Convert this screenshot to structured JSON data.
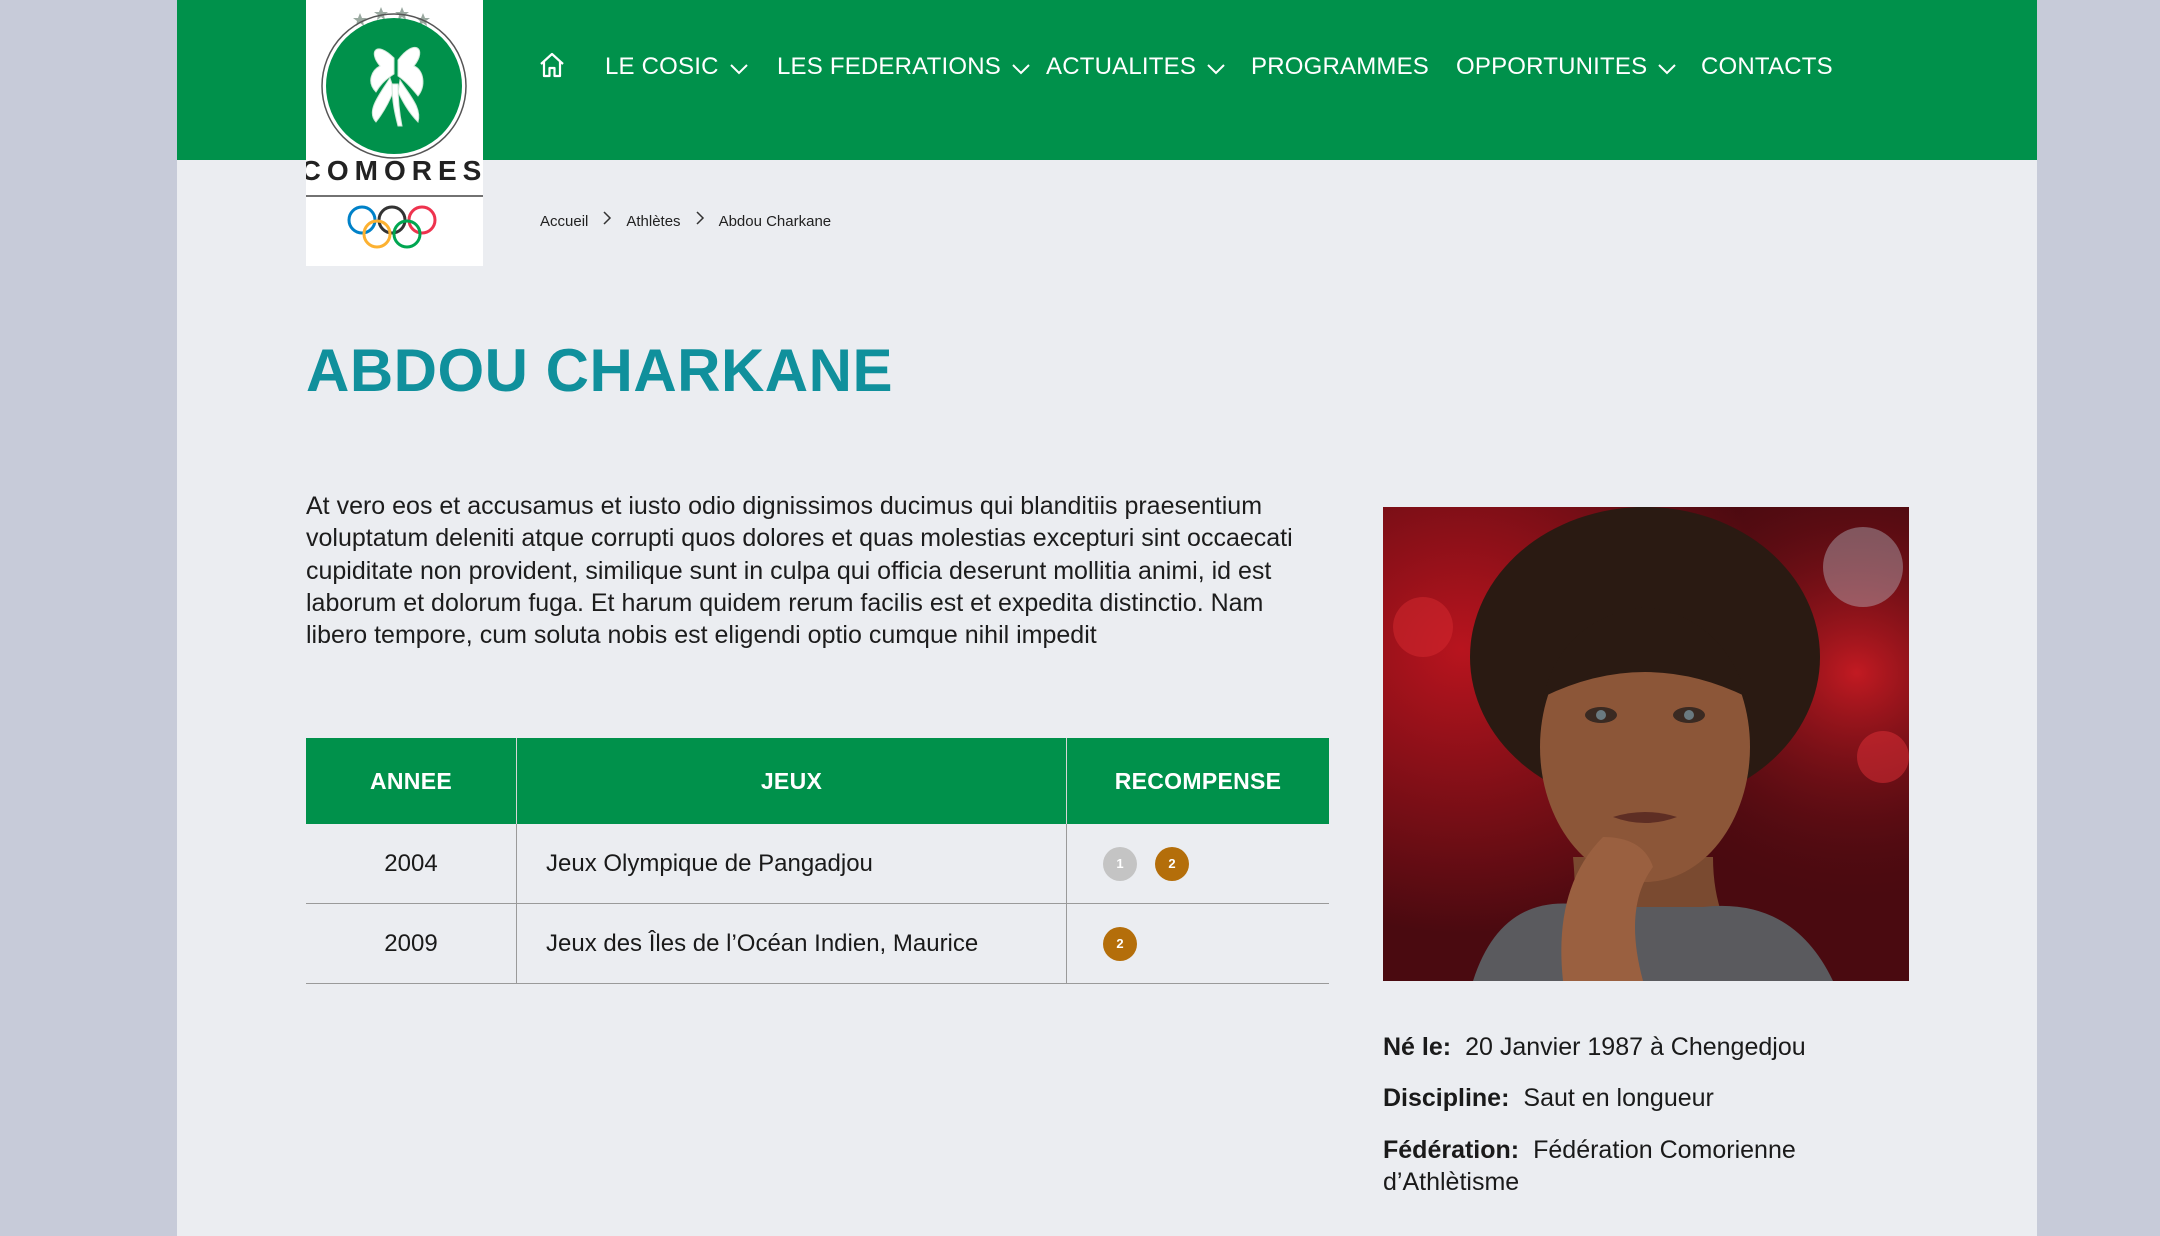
{
  "brand": {
    "logo_text": "COMORES",
    "green": "#00914b",
    "title_color": "#10909c"
  },
  "nav": {
    "home_icon": "home-icon",
    "items": [
      {
        "label": "LE COSIC",
        "has_dropdown": true
      },
      {
        "label": "LES FEDERATIONS",
        "has_dropdown": true
      },
      {
        "label": "ACTUALITES",
        "has_dropdown": true
      },
      {
        "label": "PROGRAMMES",
        "has_dropdown": false
      },
      {
        "label": "OPPORTUNITES",
        "has_dropdown": true
      },
      {
        "label": "CONTACTS",
        "has_dropdown": false
      }
    ]
  },
  "breadcrumb": [
    "Accueil",
    "Athlètes",
    "Abdou Charkane"
  ],
  "athlete": {
    "name": "ABDOU CHARKANE",
    "bio": "At vero eos et accusamus et iusto odio dignissimos ducimus qui blanditiis praesentium voluptatum deleniti atque corrupti quos dolores et quas molestias excepturi sint occaecati cupiditate non provident, similique sunt in culpa qui officia deserunt mollitia animi, id est laborum et dolorum fuga. Et harum quidem rerum facilis est et expedita distinctio. Nam libero tempore, cum soluta nobis est eligendi optio cumque nihil impedit",
    "born_label": "Né le:",
    "born_value": "20 Janvier 1987 à Chengedjou",
    "discipline_label": "Discipline:",
    "discipline_value": "Saut en longueur",
    "federation_label": "Fédération:",
    "federation_value": "Fédération Comorienne d’Athlètisme"
  },
  "awards_table": {
    "headers": [
      "ANNEE",
      "JEUX",
      "RECOMPENSE"
    ],
    "rows": [
      {
        "year": "2004",
        "games": "Jeux Olympique de Pangadjou",
        "medals": [
          {
            "label": "1",
            "color": "#c4c4c4"
          },
          {
            "label": "2",
            "color": "#b46e0a"
          }
        ]
      },
      {
        "year": "2009",
        "games": "Jeux des Îles de l’Océan Indien, Maurice",
        "medals": [
          {
            "label": "2",
            "color": "#b46e0a"
          }
        ]
      }
    ]
  }
}
